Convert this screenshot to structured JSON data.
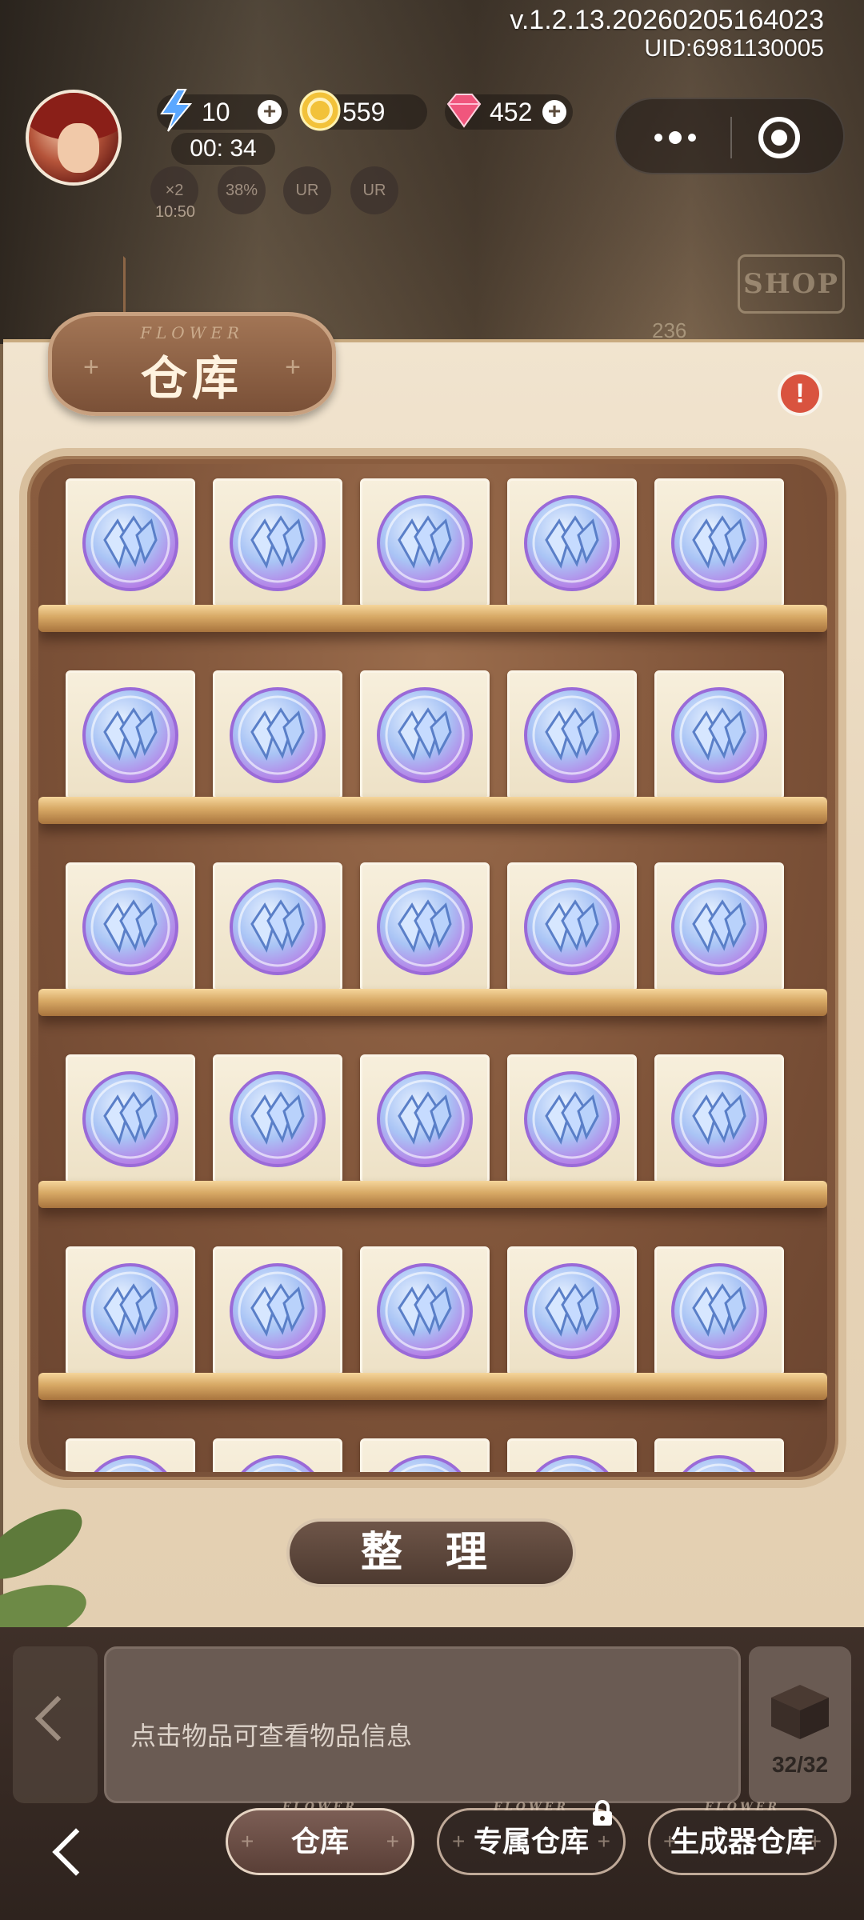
{
  "header": {
    "version": "v.1.2.13.20260205164023",
    "uid": "UID:6981130005"
  },
  "resources": {
    "energy": "10",
    "energy_timer": "00: 34",
    "coins": "559",
    "gems": "452"
  },
  "buffs": [
    {
      "label": "×2",
      "timer": "10:50"
    },
    {
      "label": "38%"
    },
    {
      "label": "UR"
    },
    {
      "label": "UR"
    }
  ],
  "shop": {
    "sign": "SHOP",
    "price": "236"
  },
  "warehouse": {
    "title_deco": "FLOWER",
    "title": "仓库",
    "organize_label": "整 理",
    "item_icon": "crystal-orb-icon",
    "rows": [
      [
        "crystal-orb",
        "crystal-orb",
        "crystal-orb",
        "crystal-orb",
        "crystal-orb"
      ],
      [
        "crystal-orb",
        "crystal-orb",
        "crystal-orb",
        "crystal-orb",
        "crystal-orb"
      ],
      [
        "crystal-orb",
        "crystal-orb",
        "crystal-orb",
        "crystal-orb",
        "crystal-orb"
      ],
      [
        "crystal-orb",
        "crystal-orb",
        "crystal-orb",
        "crystal-orb",
        "crystal-orb"
      ],
      [
        "crystal-orb",
        "crystal-orb",
        "crystal-orb",
        "crystal-orb",
        "crystal-orb"
      ],
      [
        "crystal-orb",
        "crystal-orb",
        "crystal-orb",
        "crystal-orb",
        "crystal-orb"
      ]
    ]
  },
  "info": {
    "hint": "点击物品可查看物品信息",
    "capacity": "32/32"
  },
  "tabs": [
    {
      "label": "仓库",
      "deco": "FLOWER",
      "active": true
    },
    {
      "label": "专属仓库",
      "deco": "FLOWER",
      "locked": true
    },
    {
      "label": "生成器仓库",
      "deco": "FLOWER"
    }
  ],
  "colors": {
    "accent_brown": "#7a5037",
    "shelf_gold": "#d7a864",
    "alert_red": "#d9533f"
  }
}
